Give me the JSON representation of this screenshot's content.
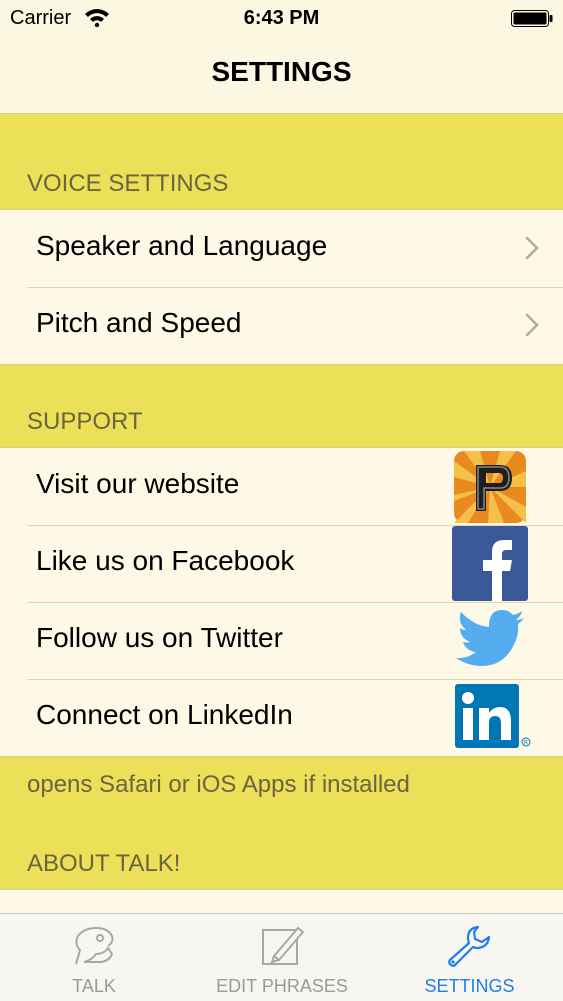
{
  "status_bar": {
    "carrier": "Carrier",
    "time": "6:43 PM"
  },
  "nav": {
    "title": "SETTINGS"
  },
  "voice_section": {
    "header": "VOICE SETTINGS",
    "items": [
      {
        "label": "Speaker and Language"
      },
      {
        "label": "Pitch and Speed"
      }
    ]
  },
  "support_section": {
    "header": "SUPPORT",
    "items": [
      {
        "label": "Visit our website",
        "icon": "app-logo-icon"
      },
      {
        "label": "Like us on Facebook",
        "icon": "facebook-icon"
      },
      {
        "label": "Follow us on Twitter",
        "icon": "twitter-icon"
      },
      {
        "label": "Connect on LinkedIn",
        "icon": "linkedin-icon"
      }
    ],
    "footer": "opens Safari or iOS Apps if installed"
  },
  "about_section": {
    "header": "ABOUT TALK!"
  },
  "tabs": [
    {
      "label": "TALK",
      "icon": "talk-icon",
      "active": false
    },
    {
      "label": "EDIT PHRASES",
      "icon": "edit-icon",
      "active": false
    },
    {
      "label": "SETTINGS",
      "icon": "wrench-icon",
      "active": true
    }
  ],
  "colors": {
    "accent": "#1f7fe6",
    "section_bg": "#ece058",
    "row_bg": "#fdf9e6"
  }
}
